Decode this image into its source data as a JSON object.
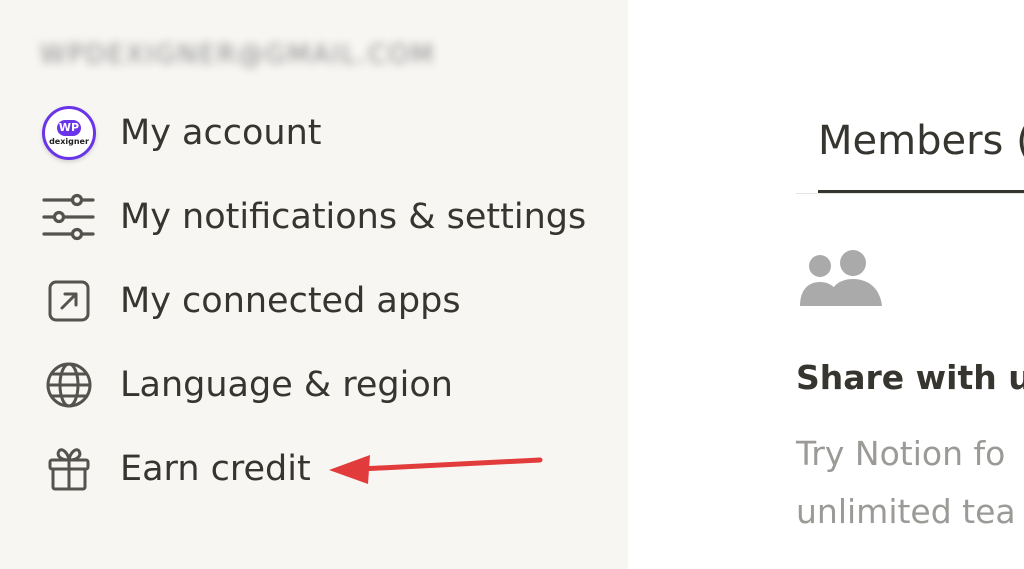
{
  "sidebar": {
    "account_email": "WPDEXIGNER@GMAIL.COM",
    "avatar": {
      "badge": "WP",
      "name": "dexigner",
      "ring_color": "#6a35e8"
    },
    "items": [
      {
        "label": "My account",
        "icon": "avatar"
      },
      {
        "label": "My notifications & settings",
        "icon": "sliders-icon"
      },
      {
        "label": "My connected apps",
        "icon": "external-link-icon"
      },
      {
        "label": "Language & region",
        "icon": "globe-icon"
      },
      {
        "label": "Earn credit",
        "icon": "gift-icon"
      }
    ],
    "annotation_arrow_color": "#e23b3b"
  },
  "main": {
    "tab_label": "Members (",
    "share_title": "Share with ur",
    "share_desc_line1": "Try Notion fo",
    "share_desc_line2": "unlimited tea",
    "icon": "people-icon"
  }
}
